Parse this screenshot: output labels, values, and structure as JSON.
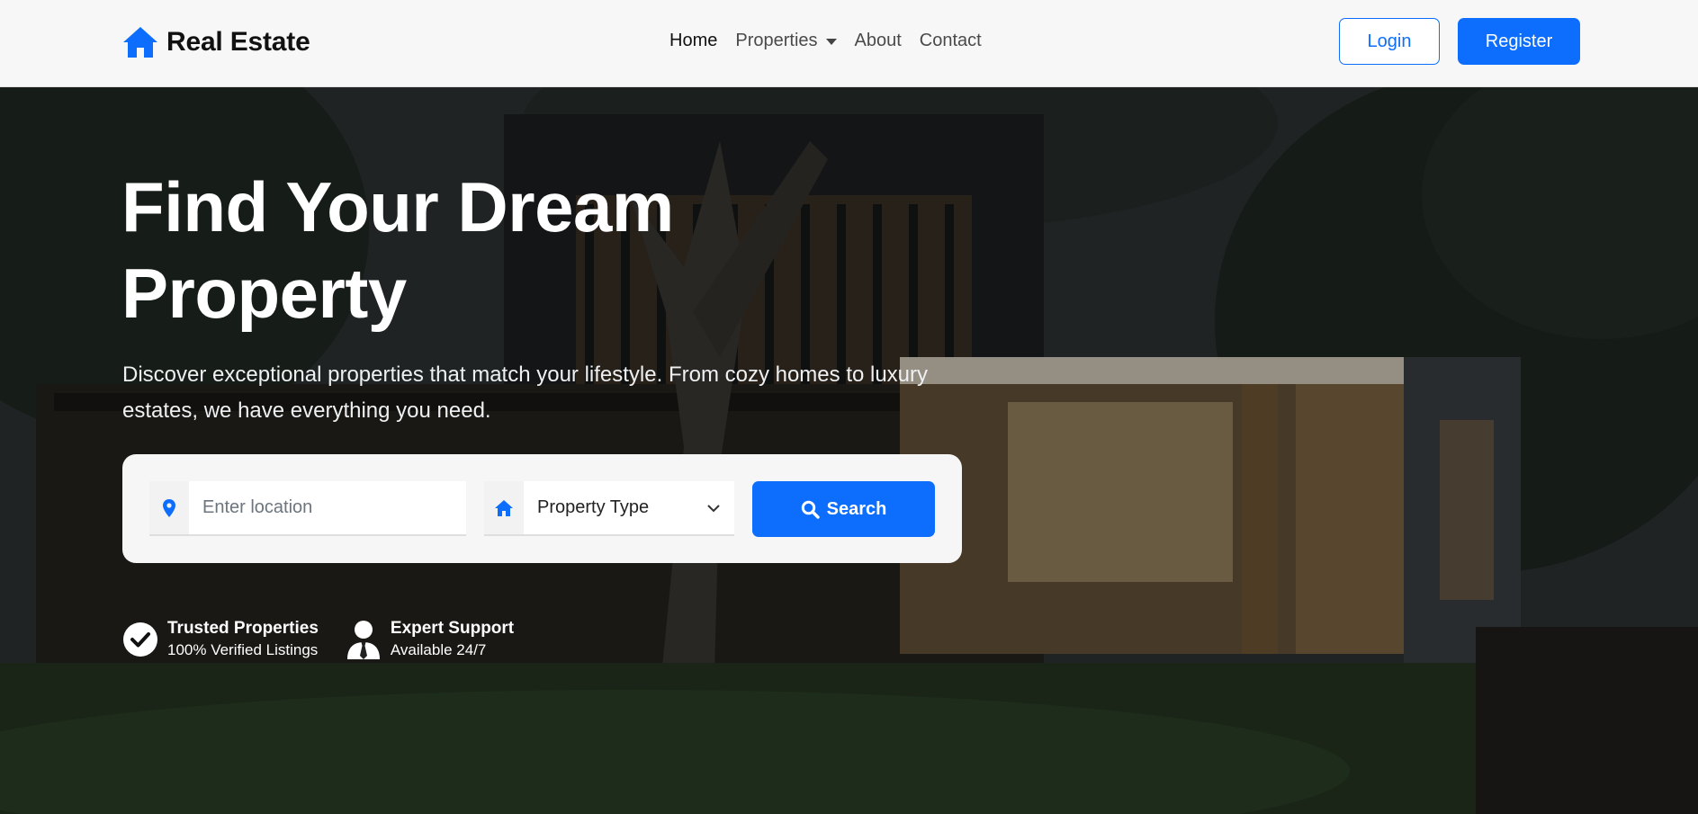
{
  "brand": {
    "name": "Real Estate",
    "icon": "home-icon",
    "color": "#0d6efd"
  },
  "nav": {
    "links": [
      "Home",
      "Properties",
      "About",
      "Contact"
    ],
    "active": "Home"
  },
  "auth": {
    "login_label": "Login",
    "register_label": "Register"
  },
  "hero": {
    "title_line1": "Find Your Dream",
    "title_line2": "Property",
    "subtitle": "Discover exceptional properties that match your lifestyle. From cozy homes to luxury estates, we have everything you need."
  },
  "search": {
    "location_placeholder": "Enter location",
    "location_icon": "map-pin-icon",
    "type_selected": "Property Type",
    "type_icon": "home-icon",
    "button_label": "Search",
    "button_icon": "search-icon"
  },
  "features": [
    {
      "icon": "check-circle-icon",
      "title": "Trusted Properties",
      "subtitle": "100% Verified Listings"
    },
    {
      "icon": "user-tie-icon",
      "title": "Expert Support",
      "subtitle": "Available 24/7"
    }
  ],
  "colors": {
    "primary": "#0d6efd",
    "navbar_bg": "#f7f7f7",
    "hero_text": "#ffffff"
  }
}
